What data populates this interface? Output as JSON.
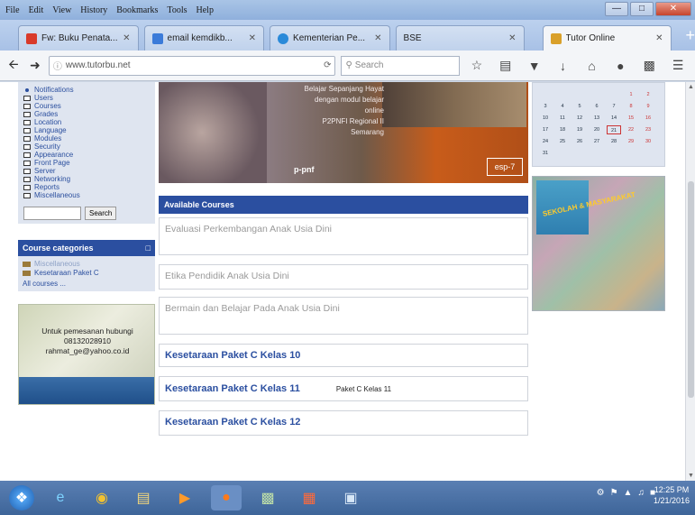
{
  "window": {
    "menu": [
      "File",
      "Edit",
      "View",
      "History",
      "Bookmarks",
      "Tools",
      "Help"
    ]
  },
  "tabs": [
    {
      "label": "Fw: Buku Penata...",
      "icon_color": "#d93a2a"
    },
    {
      "label": "email kemdikb...",
      "icon_color": "#3b7bd9"
    },
    {
      "label": "Kementerian Pe...",
      "icon_color": "#2a8ad9"
    },
    {
      "label": "BSE",
      "icon_color": "#ffffff"
    },
    {
      "label": "Tutor Online",
      "icon_color": "#d9a02a",
      "active": true
    }
  ],
  "navbar": {
    "url": "www.tutorbu.net",
    "search_placeholder": "Search"
  },
  "admin": {
    "items": [
      {
        "label": "Notifications",
        "type": "bullet"
      },
      {
        "label": "Users",
        "type": "folder"
      },
      {
        "label": "Courses",
        "type": "folder"
      },
      {
        "label": "Grades",
        "type": "folder"
      },
      {
        "label": "Location",
        "type": "folder"
      },
      {
        "label": "Language",
        "type": "folder"
      },
      {
        "label": "Modules",
        "type": "folder"
      },
      {
        "label": "Security",
        "type": "folder"
      },
      {
        "label": "Appearance",
        "type": "folder"
      },
      {
        "label": "Front Page",
        "type": "folder"
      },
      {
        "label": "Server",
        "type": "folder"
      },
      {
        "label": "Networking",
        "type": "folder"
      },
      {
        "label": "Reports",
        "type": "folder"
      },
      {
        "label": "Miscellaneous",
        "type": "folder"
      }
    ],
    "search_button": "Search"
  },
  "categories": {
    "title": "Course categories",
    "items": [
      {
        "label": "Miscellaneous",
        "faded": true
      },
      {
        "label": "Kesetaraan Paket C",
        "faded": false
      }
    ],
    "more": "All courses ..."
  },
  "contact": {
    "line1": "Untuk pemesanan hubungi",
    "line2": "08132028910",
    "line3": "rahmat_ge@yahoo.co.id"
  },
  "banner": {
    "text1": "Belajar Sepanjang Hayat",
    "text2": "dengan modul belajar online",
    "text3": "P2PNFI Regional II",
    "text4": "Semarang",
    "logo": "p-pnf",
    "badge": "esp-7"
  },
  "courses": {
    "header": "Available Courses",
    "items": [
      {
        "title": "Evaluasi Perkembangan Anak Usia Dini",
        "active": false,
        "summary": ""
      },
      {
        "title": "Etika Pendidik Anak Usia Dini",
        "active": false,
        "summary": ""
      },
      {
        "title": "Bermain dan Belajar Pada Anak Usia Dini",
        "active": false,
        "summary": ""
      },
      {
        "title": "Kesetaraan Paket C Kelas 10",
        "active": true,
        "summary": ""
      },
      {
        "title": "Kesetaraan Paket C Kelas 11",
        "active": true,
        "summary": "Paket C Kelas 11"
      },
      {
        "title": "Kesetaraan Paket C Kelas 12",
        "active": true,
        "summary": ""
      }
    ]
  },
  "calendar": {
    "cells": [
      "",
      "",
      "",
      "",
      "",
      "1",
      "2",
      "3",
      "4",
      "5",
      "6",
      "7",
      "8",
      "9",
      "10",
      "11",
      "12",
      "13",
      "14",
      "15",
      "16",
      "17",
      "18",
      "19",
      "20",
      "21",
      "22",
      "23",
      "24",
      "25",
      "26",
      "27",
      "28",
      "29",
      "30",
      "31",
      "",
      "",
      "",
      "",
      "",
      ""
    ],
    "today": "21"
  },
  "book": {
    "title": "SEKOLAH & MASYARAKAT"
  },
  "taskbar": {
    "time": "12:25 PM",
    "date": "1/21/2016"
  }
}
